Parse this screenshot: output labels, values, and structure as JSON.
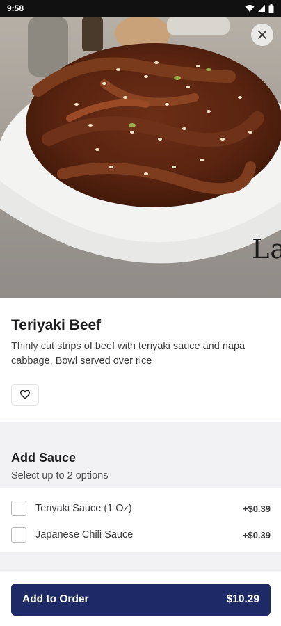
{
  "status_bar": {
    "time": "9:58"
  },
  "hero": {
    "watermark_text": "La"
  },
  "item": {
    "name": "Teriyaki Beef",
    "description": "Thinly cut strips of beef with teriyaki sauce and napa cabbage. Bowl served over rice"
  },
  "sauce_group": {
    "title": "Add Sauce",
    "subtitle": "Select up to 2 options",
    "options": [
      {
        "label": "Teriyaki Sauce (1 Oz)",
        "price": "+$0.39",
        "checked": false
      },
      {
        "label": "Japanese Chili Sauce",
        "price": "+$0.39",
        "checked": false
      }
    ]
  },
  "footer": {
    "button_label": "Add to Order",
    "total": "$10.29"
  },
  "colors": {
    "primary_button": "#1e2a66",
    "section_background": "#f2f2f4"
  },
  "icons": [
    "close-icon",
    "heart-outline-icon",
    "wifi-icon",
    "signal-icon",
    "battery-icon"
  ]
}
